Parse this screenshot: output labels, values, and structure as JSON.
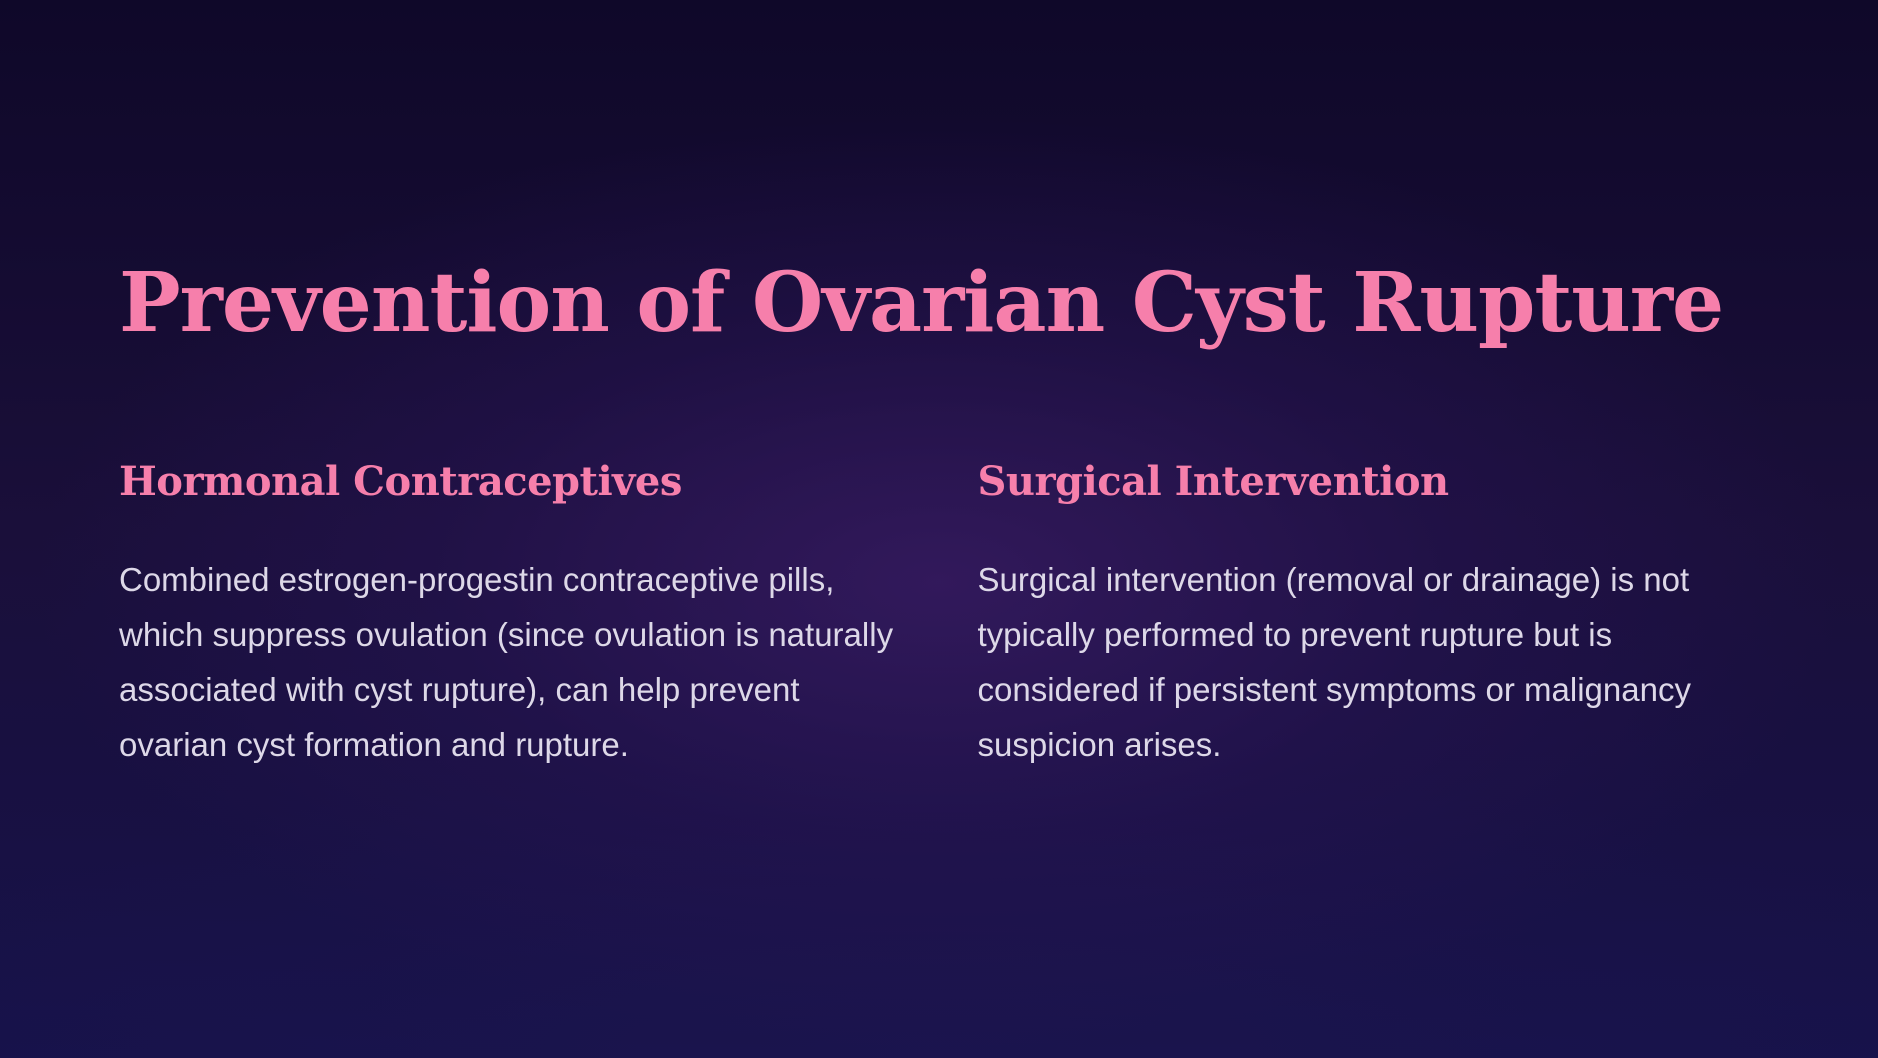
{
  "slide": {
    "title": "Prevention of Ovarian Cyst Rupture",
    "columns": [
      {
        "heading": "Hormonal Contraceptives",
        "body": "Combined estrogen-progestin contraceptive pills, which suppress ovulation (since ovulation is naturally associated with cyst rupture), can help prevent ovarian cyst formation and rupture."
      },
      {
        "heading": "Surgical Intervention",
        "body": "Surgical intervention (removal or drainage) is not typically performed to prevent rupture but is considered if persistent symptoms or malignancy suspicion arises."
      }
    ]
  },
  "colors": {
    "background": "#120a2e",
    "accent": "#f67fab",
    "body_text": "#ddd8e8"
  }
}
